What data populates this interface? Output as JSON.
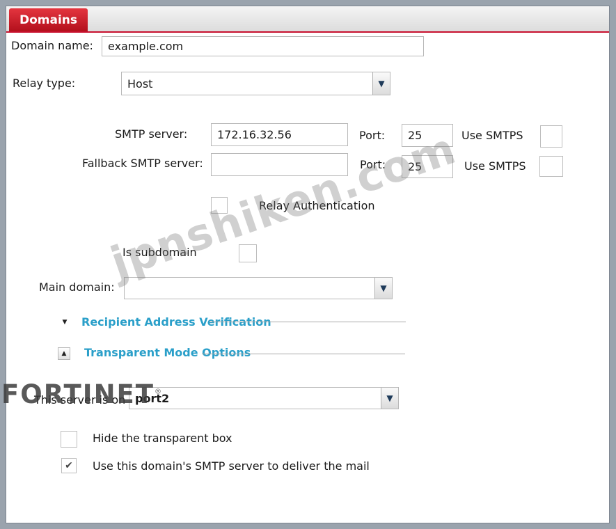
{
  "tab": {
    "label": "Domains"
  },
  "domain_name": {
    "label": "Domain name:",
    "value": "example.com"
  },
  "relay_type": {
    "label": "Relay type:",
    "value": "Host"
  },
  "smtp": {
    "server_label": "SMTP server:",
    "server_value": "172.16.32.56",
    "port_label": "Port:",
    "port_value": "25",
    "smtps_label": "Use SMTPS"
  },
  "fallback": {
    "server_label": "Fallback SMTP server:",
    "server_value": "",
    "port_label": "Port:",
    "port_value": "25",
    "smtps_label": "Use SMTPS"
  },
  "relay_auth": {
    "label": "Relay Authentication"
  },
  "subdomain": {
    "label": "Is subdomain"
  },
  "main_domain": {
    "label": "Main domain:",
    "value": ""
  },
  "sections": {
    "recipient": "Recipient Address Verification",
    "transparent": "Transparent Mode Options"
  },
  "server_on": {
    "label": "This server is on",
    "value": "port2"
  },
  "hide_box": {
    "label": "Hide the transparent box",
    "checked": false
  },
  "use_smtp": {
    "label": "Use this domain's SMTP server to deliver the mail",
    "checked": true
  },
  "branding": {
    "logo": "FORTINET",
    "watermark": "jpnshiken.com"
  }
}
